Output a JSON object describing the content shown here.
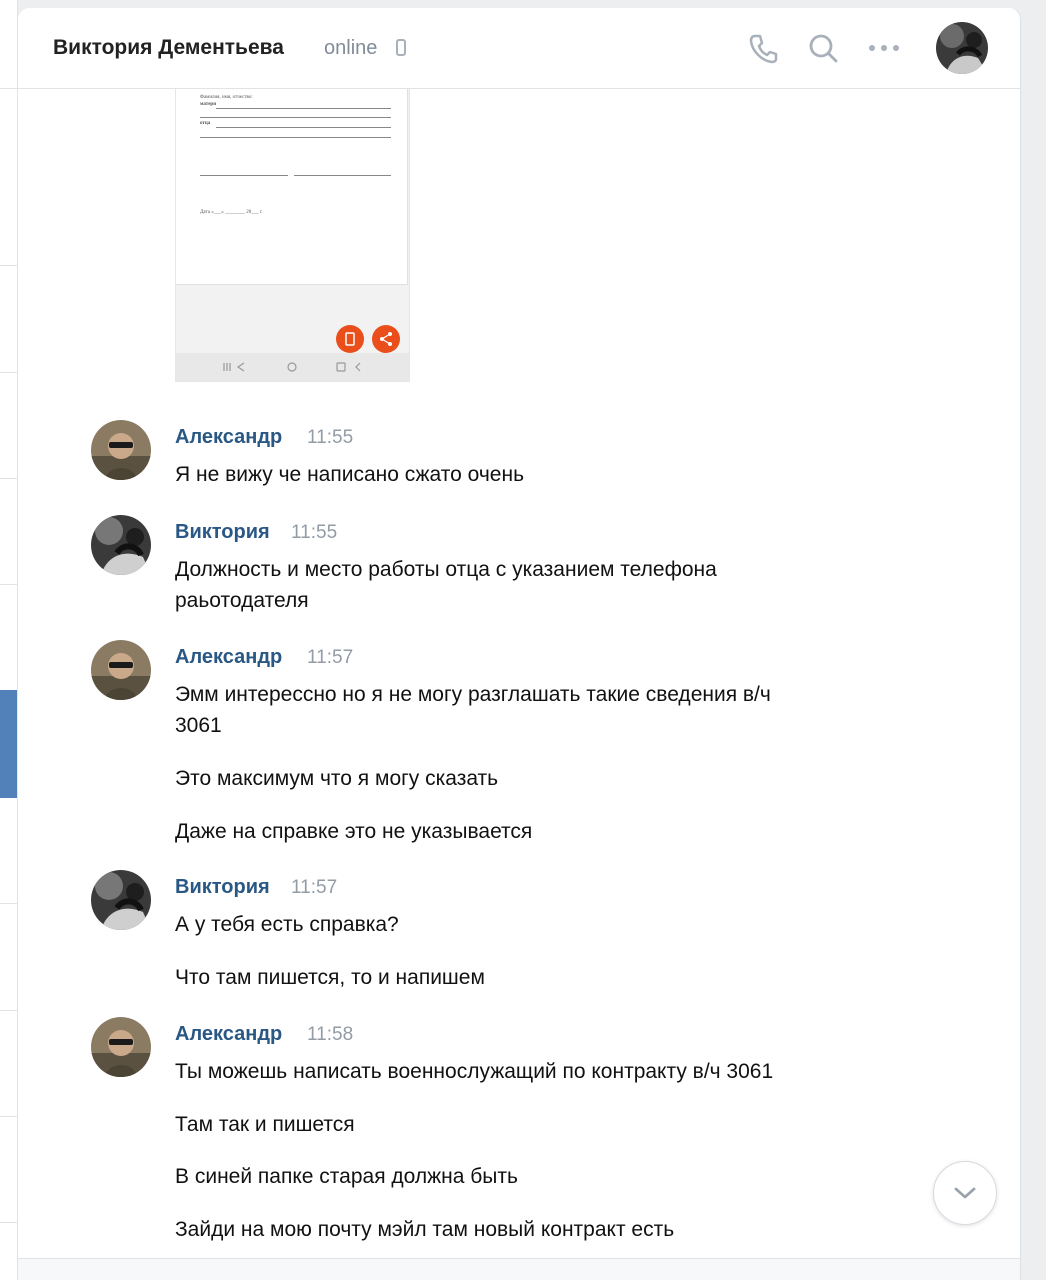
{
  "header": {
    "contact_name": "Виктория Дементьева",
    "status": "online",
    "icons": [
      "phone-icon",
      "search-icon",
      "more-icon",
      "mobile-device-icon"
    ]
  },
  "attachment": {
    "type": "document-screenshot",
    "doc_lines": [
      "Фамилия, имя, отчество:",
      "матери",
      "отца",
      "Дата «___» ________ 20___ г."
    ]
  },
  "messages": [
    {
      "author": "Александр",
      "time": "11:55",
      "avatar": "alexander",
      "lines": [
        "Я не вижу че написано сжато очень"
      ]
    },
    {
      "author": "Виктория",
      "time": "11:55",
      "avatar": "victoria",
      "lines": [
        "Должность и место работы отца с указанием телефона",
        "раьотодателя"
      ]
    },
    {
      "author": "Александр",
      "time": "11:57",
      "avatar": "alexander",
      "lines": [
        "Эмм интерессно но я не могу разглашать такие сведения в/ч",
        "3061",
        "Это максимум что я могу сказать",
        "Даже на справке это не указывается"
      ]
    },
    {
      "author": "Виктория",
      "time": "11:57",
      "avatar": "victoria",
      "lines": [
        "А у тебя есть справка?",
        "Что там пишется, то и напишем"
      ]
    },
    {
      "author": "Александр",
      "time": "11:58",
      "avatar": "alexander",
      "lines": [
        "Ты можешь написать военнослужащий по контракту в/ч 3061",
        "Там так и пишется",
        "В синей папке старая должна быть",
        "Зайди на мою почту мэйл там новый контракт есть"
      ]
    }
  ],
  "scroll_button": {
    "icon": "chevron-down-icon"
  },
  "colors": {
    "author": "#2a5885",
    "time": "#939ba5",
    "accent": "#5181b8",
    "fab": "#e94e1b"
  }
}
